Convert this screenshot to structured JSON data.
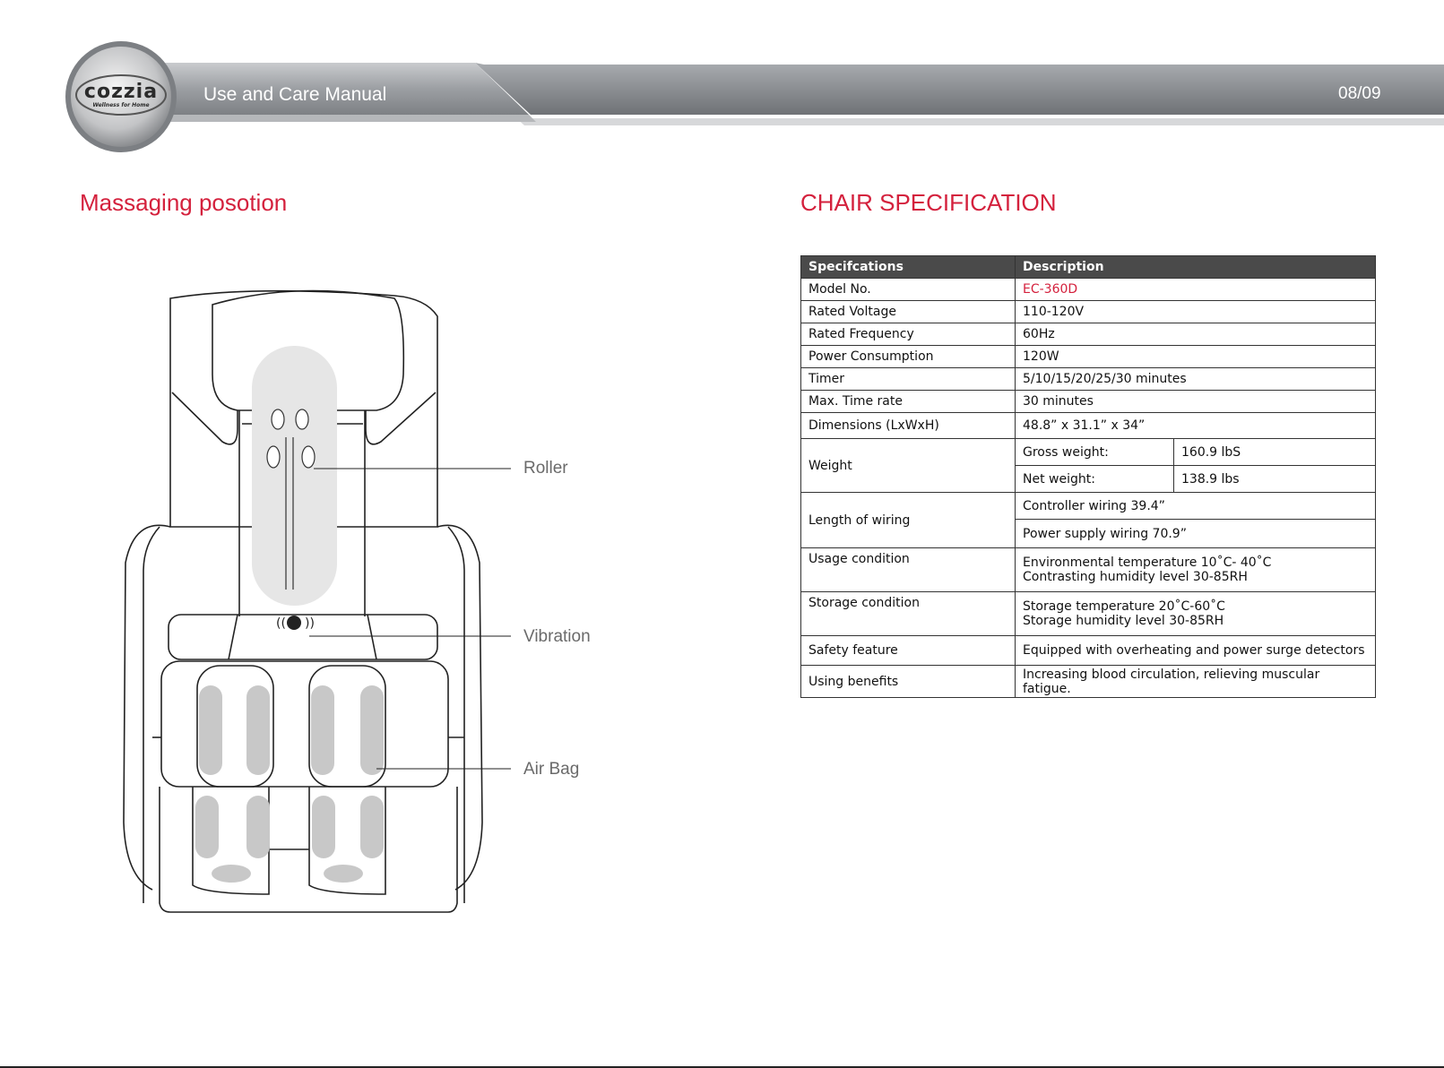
{
  "header": {
    "logo_text": "cozzia",
    "logo_tagline": "Wellness for Home",
    "title": "Use and Care Manual",
    "page_number": "08/09"
  },
  "left": {
    "title": "Massaging posotion",
    "callouts": [
      "Roller",
      "Vibration",
      "Air Bag"
    ]
  },
  "right": {
    "title": "CHAIR SPECIFICATION",
    "table": {
      "headers": [
        "Specifcations",
        "Description"
      ],
      "rows": [
        {
          "spec": "Model No.",
          "desc": "EC-360D"
        },
        {
          "spec": "Rated Voltage",
          "desc": "110-120V"
        },
        {
          "spec": "Rated Frequency",
          "desc": "60Hz"
        },
        {
          "spec": "Power Consumption",
          "desc": "120W"
        },
        {
          "spec": "Timer",
          "desc": "5/10/15/20/25/30 minutes"
        },
        {
          "spec": "Max. Time rate",
          "desc": "30 minutes"
        },
        {
          "spec": "Dimensions (LxWxH)",
          "desc": "48.8” x 31.1” x 34”"
        }
      ],
      "weight": {
        "spec": "Weight",
        "gross_label": "Gross weight:",
        "gross_value": "160.9 lbS",
        "net_label": "Net weight:",
        "net_value": "138.9 lbs"
      },
      "wiring": {
        "spec": "Length of wiring",
        "controller": "Controller wiring 39.4”",
        "power": "Power supply wiring 70.9”"
      },
      "usage": {
        "spec": "Usage condition",
        "line1": "Environmental temperature 10˚C- 40˚C",
        "line2": "Contrasting humidity level 30-85RH"
      },
      "storage": {
        "spec": "Storage condition",
        "line1": "Storage temperature 20˚C-60˚C",
        "line2": "Storage humidity level 30-85RH"
      },
      "safety": {
        "spec": "Safety feature",
        "desc": "Equipped with overheating and power surge detectors"
      },
      "benefits": {
        "spec": "Using benefits",
        "desc": "Increasing blood circulation, relieving muscular fatigue."
      }
    }
  }
}
